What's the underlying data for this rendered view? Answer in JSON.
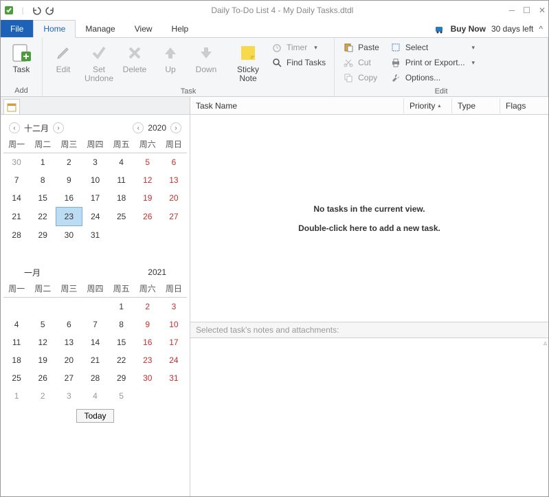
{
  "title": "Daily To-Do List 4 - My Daily Tasks.dtdl",
  "menubar": {
    "file": "File",
    "home": "Home",
    "manage": "Manage",
    "view": "View",
    "help": "Help",
    "buy": "Buy Now",
    "days_left": "30 days left"
  },
  "ribbon": {
    "add": {
      "label": "Add",
      "task": "Task"
    },
    "task": {
      "label": "Task",
      "edit": "Edit",
      "set_undone": "Set\nUndone",
      "delete": "Delete",
      "up": "Up",
      "down": "Down",
      "sticky": "Sticky\nNote",
      "timer": "Timer",
      "find": "Find Tasks"
    },
    "edit": {
      "label": "Edit",
      "paste": "Paste",
      "cut": "Cut",
      "copy": "Copy",
      "select": "Select",
      "print": "Print or Export...",
      "options": "Options..."
    }
  },
  "calendar1": {
    "month": "十二月",
    "year": "2020",
    "dow": [
      "周一",
      "周二",
      "周三",
      "周四",
      "周五",
      "周六",
      "周日"
    ],
    "rows": [
      [
        {
          "d": "30",
          "o": true
        },
        {
          "d": "1"
        },
        {
          "d": "2"
        },
        {
          "d": "3"
        },
        {
          "d": "4"
        },
        {
          "d": "5",
          "w": true
        },
        {
          "d": "6",
          "w": true
        }
      ],
      [
        {
          "d": "7"
        },
        {
          "d": "8"
        },
        {
          "d": "9"
        },
        {
          "d": "10"
        },
        {
          "d": "11"
        },
        {
          "d": "12",
          "w": true
        },
        {
          "d": "13",
          "w": true
        }
      ],
      [
        {
          "d": "14"
        },
        {
          "d": "15"
        },
        {
          "d": "16"
        },
        {
          "d": "17"
        },
        {
          "d": "18"
        },
        {
          "d": "19",
          "w": true
        },
        {
          "d": "20",
          "w": true
        }
      ],
      [
        {
          "d": "21"
        },
        {
          "d": "22"
        },
        {
          "d": "23",
          "s": true
        },
        {
          "d": "24"
        },
        {
          "d": "25"
        },
        {
          "d": "26",
          "w": true
        },
        {
          "d": "27",
          "w": true
        }
      ],
      [
        {
          "d": "28"
        },
        {
          "d": "29"
        },
        {
          "d": "30"
        },
        {
          "d": "31"
        },
        {
          "d": ""
        },
        {
          "d": ""
        },
        {
          "d": ""
        }
      ]
    ]
  },
  "calendar2": {
    "month": "一月",
    "year": "2021",
    "dow": [
      "周一",
      "周二",
      "周三",
      "周四",
      "周五",
      "周六",
      "周日"
    ],
    "rows": [
      [
        {
          "d": ""
        },
        {
          "d": ""
        },
        {
          "d": ""
        },
        {
          "d": ""
        },
        {
          "d": "1"
        },
        {
          "d": "2",
          "w": true
        },
        {
          "d": "3",
          "w": true
        }
      ],
      [
        {
          "d": "4"
        },
        {
          "d": "5"
        },
        {
          "d": "6"
        },
        {
          "d": "7"
        },
        {
          "d": "8"
        },
        {
          "d": "9",
          "w": true
        },
        {
          "d": "10",
          "w": true
        }
      ],
      [
        {
          "d": "11"
        },
        {
          "d": "12"
        },
        {
          "d": "13"
        },
        {
          "d": "14"
        },
        {
          "d": "15"
        },
        {
          "d": "16",
          "w": true
        },
        {
          "d": "17",
          "w": true
        }
      ],
      [
        {
          "d": "18"
        },
        {
          "d": "19"
        },
        {
          "d": "20"
        },
        {
          "d": "21"
        },
        {
          "d": "22"
        },
        {
          "d": "23",
          "w": true
        },
        {
          "d": "24",
          "w": true
        }
      ],
      [
        {
          "d": "25"
        },
        {
          "d": "26"
        },
        {
          "d": "27"
        },
        {
          "d": "28"
        },
        {
          "d": "29"
        },
        {
          "d": "30",
          "w": true
        },
        {
          "d": "31",
          "w": true
        }
      ],
      [
        {
          "d": "1",
          "o": true
        },
        {
          "d": "2",
          "o": true
        },
        {
          "d": "3",
          "o": true
        },
        {
          "d": "4",
          "o": true
        },
        {
          "d": "5",
          "o": true
        },
        {
          "d": ""
        },
        {
          "d": ""
        }
      ]
    ],
    "today": "Today"
  },
  "tasklist": {
    "cols": {
      "name": "Task Name",
      "priority": "Priority",
      "type": "Type",
      "flags": "Flags"
    },
    "empty1": "No tasks in the current view.",
    "empty2": "Double-click here to add a new task."
  },
  "notes": {
    "header": "Selected task's notes and attachments:"
  }
}
